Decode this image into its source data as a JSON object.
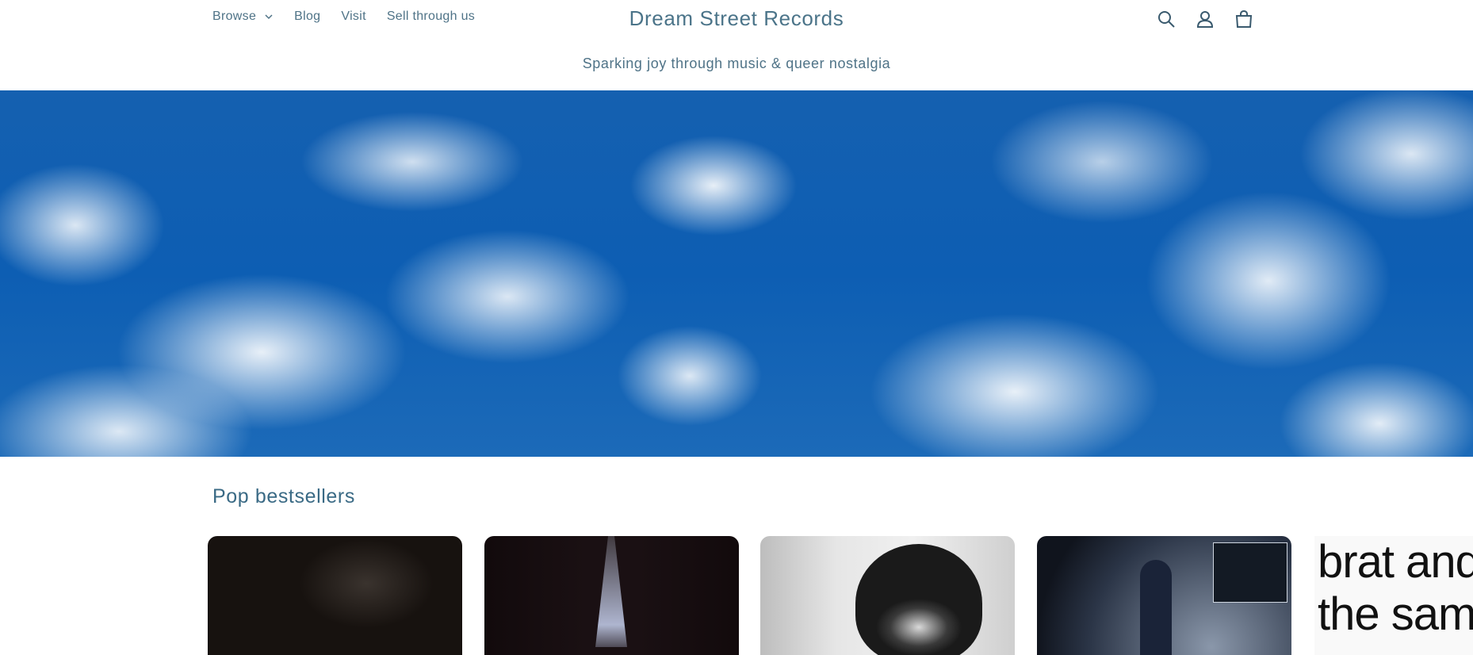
{
  "header": {
    "nav": [
      "Browse",
      "Blog",
      "Visit",
      "Sell through us"
    ],
    "brand": "Dream Street Records",
    "tagline": "Sparking joy through music & queer nostalgia",
    "icons": [
      "search-icon",
      "account-icon",
      "cart-icon"
    ]
  },
  "colors": {
    "accent": "#4b7489",
    "sky": "#0d5eb3"
  },
  "section": {
    "title": "Pop bestsellers"
  },
  "products": [
    {
      "name": "album-cover-1"
    },
    {
      "name": "album-cover-2"
    },
    {
      "name": "album-cover-3"
    },
    {
      "name": "album-cover-4"
    },
    {
      "name": "album-cover-5",
      "cover_text": "brat and\nthe sam"
    }
  ]
}
